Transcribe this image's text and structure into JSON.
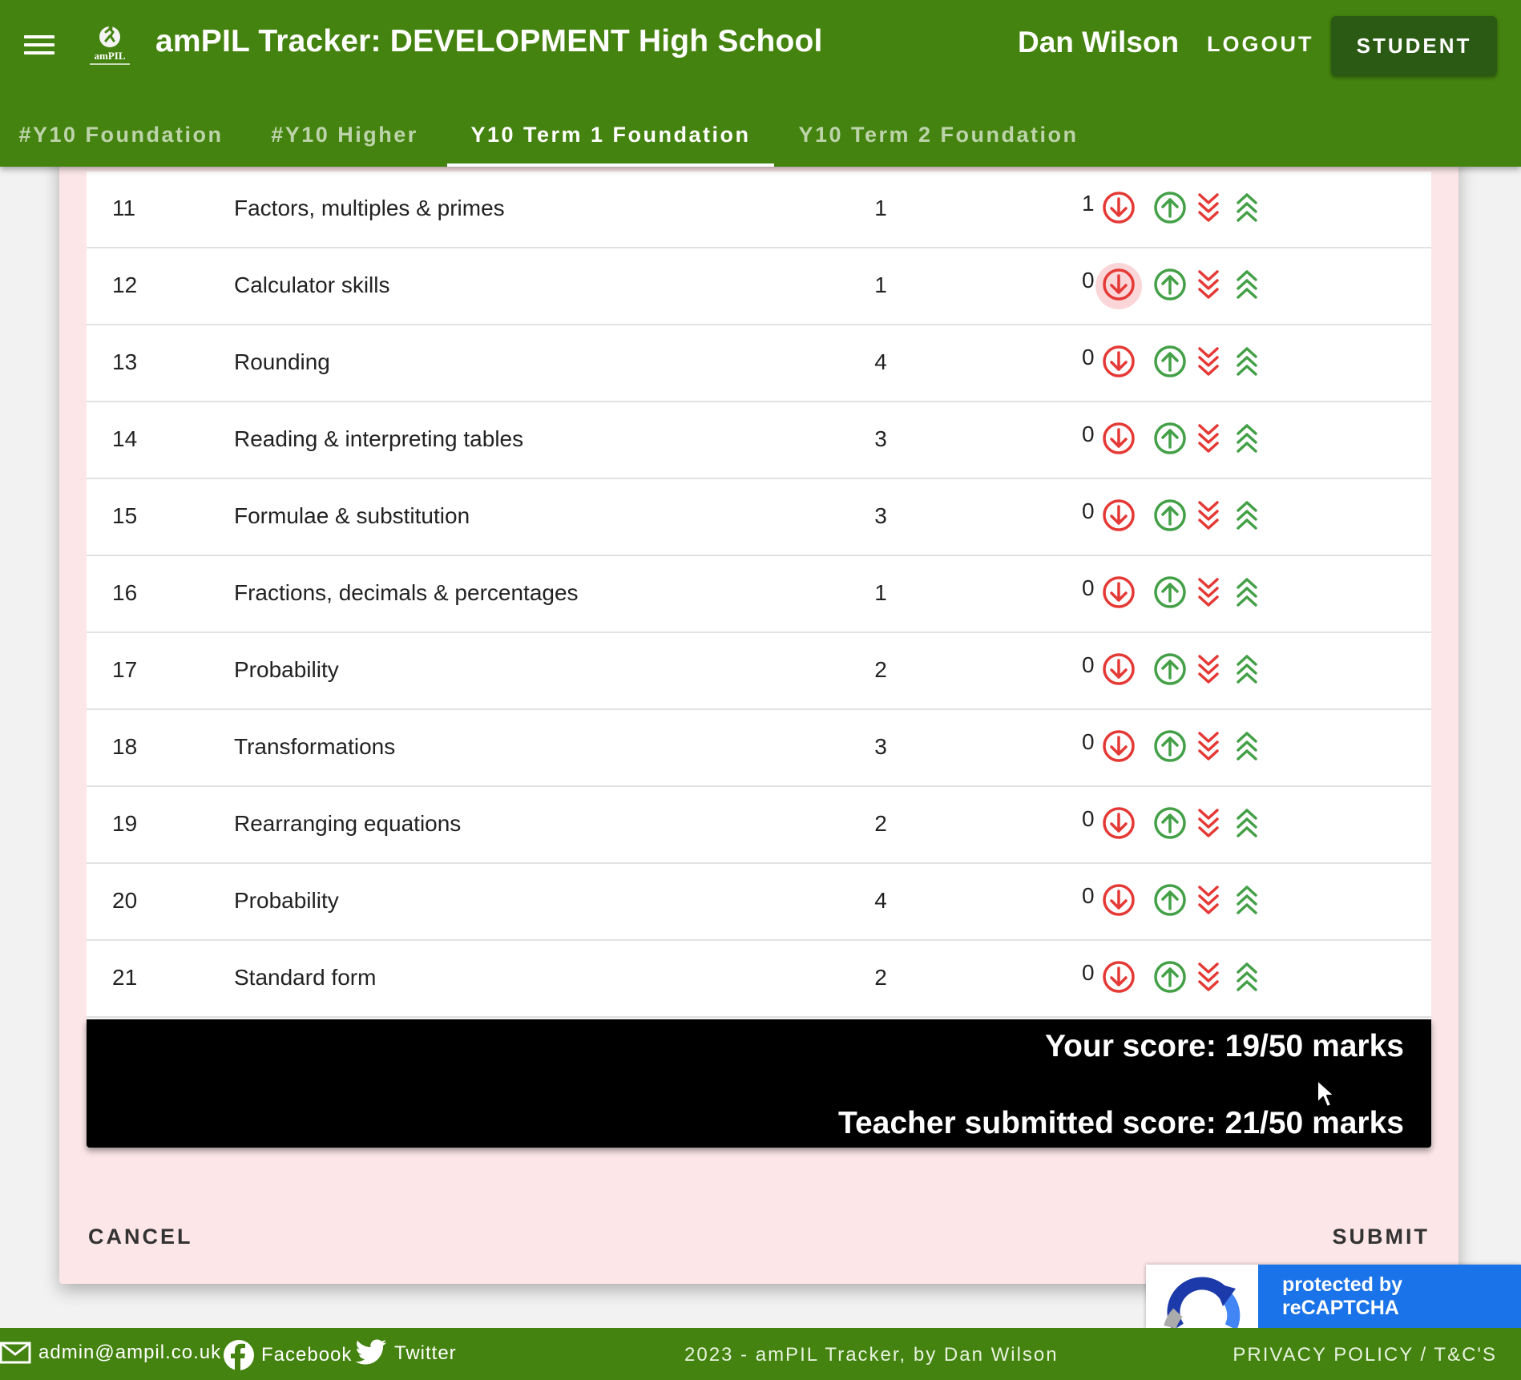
{
  "header": {
    "title": "amPIL Tracker: DEVELOPMENT High School",
    "user_name": "Dan Wilson",
    "logout_label": "LOGOUT",
    "student_label": "STUDENT",
    "logo_text": "amPIL"
  },
  "tabs": [
    {
      "label": "#Y10 Foundation",
      "active": false
    },
    {
      "label": "#Y10 Higher",
      "active": false
    },
    {
      "label": "Y10 Term 1 Foundation",
      "active": true
    },
    {
      "label": "Y10 Term 2 Foundation",
      "active": false
    }
  ],
  "questions": [
    {
      "num": "11",
      "topic": "Factors, multiples & primes",
      "max": "1",
      "score": "1"
    },
    {
      "num": "12",
      "topic": "Calculator skills",
      "max": "1",
      "score": "0"
    },
    {
      "num": "13",
      "topic": "Rounding",
      "max": "4",
      "score": "0"
    },
    {
      "num": "14",
      "topic": "Reading & interpreting tables",
      "max": "3",
      "score": "0"
    },
    {
      "num": "15",
      "topic": "Formulae & substitution",
      "max": "3",
      "score": "0"
    },
    {
      "num": "16",
      "topic": "Fractions, decimals & percentages",
      "max": "1",
      "score": "0"
    },
    {
      "num": "17",
      "topic": "Probability",
      "max": "2",
      "score": "0"
    },
    {
      "num": "18",
      "topic": "Transformations",
      "max": "3",
      "score": "0"
    },
    {
      "num": "19",
      "topic": "Rearranging equations",
      "max": "2",
      "score": "0"
    },
    {
      "num": "20",
      "topic": "Probability",
      "max": "4",
      "score": "0"
    },
    {
      "num": "21",
      "topic": "Standard form",
      "max": "2",
      "score": "0"
    }
  ],
  "score": {
    "your_score": "Your score: 19/50 marks",
    "teacher_score": "Teacher submitted score: 21/50 marks"
  },
  "actions": {
    "cancel_label": "CANCEL",
    "submit_label": "SUBMIT"
  },
  "recaptcha": {
    "label": "protected by reCAPTCHA"
  },
  "footer": {
    "email": "admin@ampil.co.uk",
    "facebook": "Facebook",
    "twitter": "Twitter",
    "copyright": "2023 - amPIL Tracker, by Dan Wilson",
    "privacy": "PRIVACY POLICY / T&C'S"
  },
  "icons": {
    "decrease": "arrow-down-circle-icon",
    "increase": "arrow-up-circle-icon",
    "set_min": "double-chevron-down-icon",
    "set_max": "double-chevron-up-icon"
  },
  "colors": {
    "brand_green": "#44830f",
    "dark_green": "#2a5a14",
    "decrease_red": "#e53935",
    "increase_green": "#43a047",
    "dialog_pink": "#fce6e8"
  }
}
